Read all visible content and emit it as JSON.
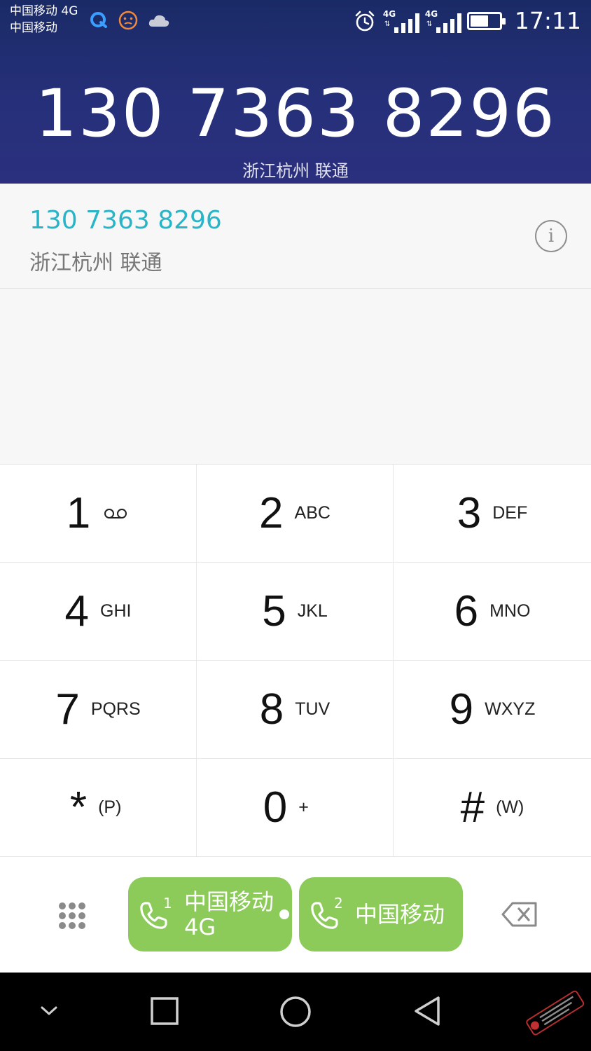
{
  "status_bar": {
    "carrier_line1": "中国移动 4G",
    "carrier_line2": "中国移动",
    "signal1_tag": "4G",
    "signal2_tag": "4G",
    "battery_level": 0.62,
    "time": "17:11"
  },
  "header": {
    "dialed_number": "130 7363 8296",
    "location": "浙江杭州 联通"
  },
  "match": {
    "number": "130 7363 8296",
    "location": "浙江杭州 联通",
    "info_glyph": "i"
  },
  "keypad": {
    "keys": [
      {
        "digit": "1",
        "sub": ""
      },
      {
        "digit": "2",
        "sub": "ABC"
      },
      {
        "digit": "3",
        "sub": "DEF"
      },
      {
        "digit": "4",
        "sub": "GHI"
      },
      {
        "digit": "5",
        "sub": "JKL"
      },
      {
        "digit": "6",
        "sub": "MNO"
      },
      {
        "digit": "7",
        "sub": "PQRS"
      },
      {
        "digit": "8",
        "sub": "TUV"
      },
      {
        "digit": "9",
        "sub": "WXYZ"
      },
      {
        "digit": "*",
        "sub": "(P)"
      },
      {
        "digit": "0",
        "sub": "+"
      },
      {
        "digit": "#",
        "sub": "(W)"
      }
    ]
  },
  "actions": {
    "sim1": {
      "slot": "1",
      "line1": "中国移动",
      "line2": "4G"
    },
    "sim2": {
      "slot": "2",
      "line1": "中国移动"
    }
  },
  "colors": {
    "accent_teal": "#28b5c8",
    "call_green": "#8ccb5a",
    "header_navy": "#26307a"
  }
}
